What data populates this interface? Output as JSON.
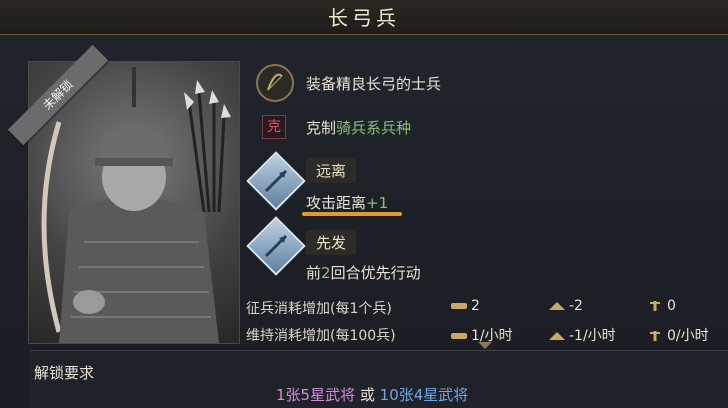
{
  "header": {
    "title": "长弓兵"
  },
  "portrait": {
    "locked_badge": "未解锁"
  },
  "traits": [
    {
      "icon": "bow-icon",
      "text": "装备精良长弓的士兵"
    },
    {
      "icon": "counter-icon",
      "icon_text": "克",
      "prefix": "克制",
      "highlight": "骑兵系兵种"
    }
  ],
  "skills": [
    {
      "icon": "arrow-skill-icon",
      "name": "远离",
      "desc_prefix": "攻击距离",
      "desc_value": "+1"
    },
    {
      "icon": "arrow-skill-icon",
      "name": "先发",
      "desc_prefix": "前",
      "desc_value": "2",
      "desc_suffix": "回合优先行动"
    }
  ],
  "stats": {
    "recruit_label": "征兵消耗增加(每1个兵)",
    "recruit_values": [
      "2",
      "-2",
      "0"
    ],
    "upkeep_label": "维持消耗增加(每100兵)",
    "upkeep_values": [
      "1/小时",
      "-1/小时",
      "0/小时"
    ]
  },
  "unlock": {
    "label": "解锁要求",
    "option_a": "1张5星武将",
    "or_text": "或",
    "option_b": "10张4星武将"
  },
  "colors": {
    "accent_gold": "#e49a2a",
    "highlight_green": "#86c17a",
    "counter_red": "#e04a68"
  }
}
